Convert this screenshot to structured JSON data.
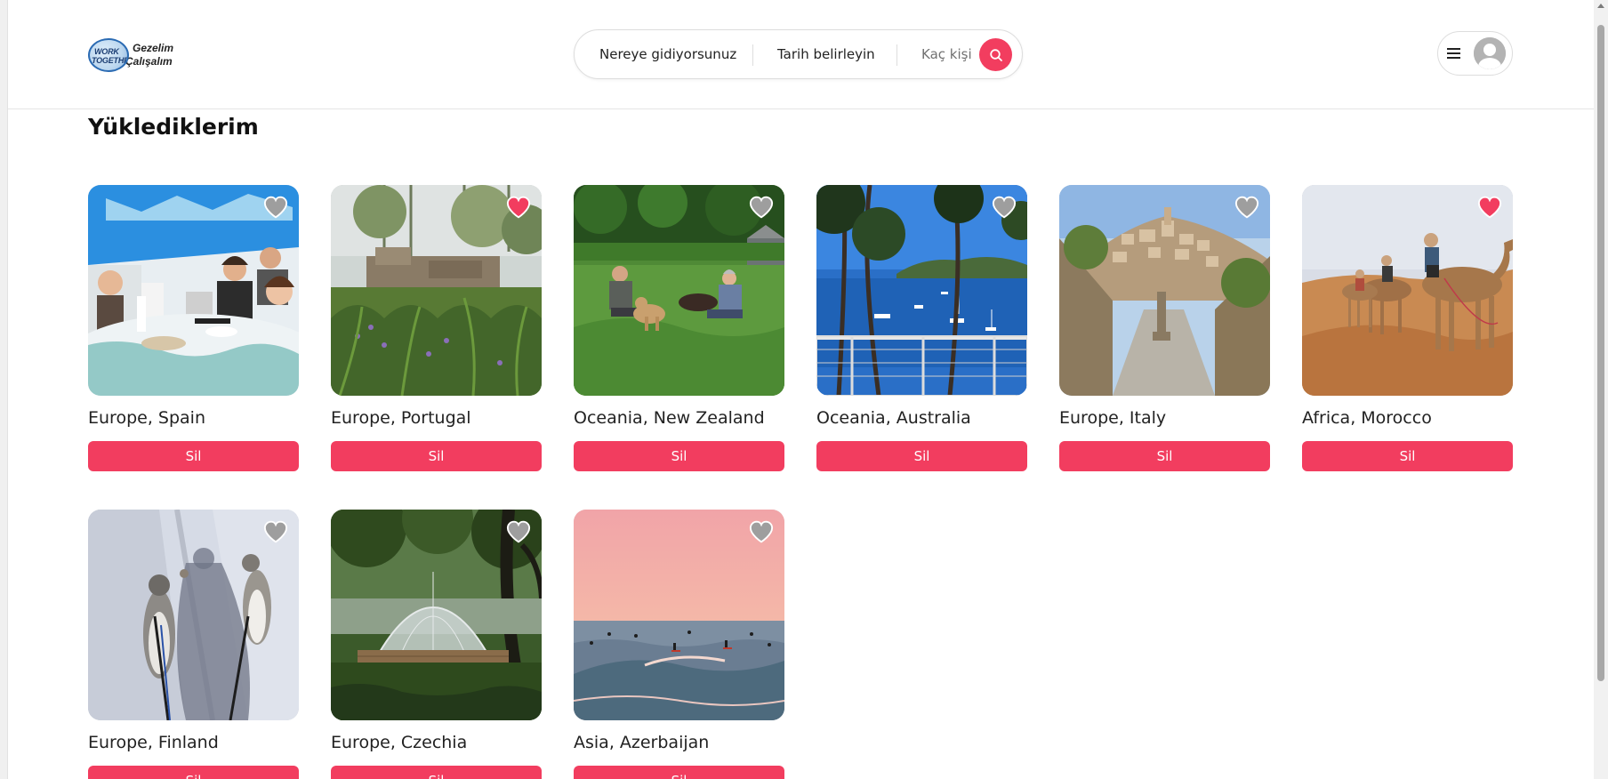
{
  "header": {
    "logo": {
      "line1": "WORK",
      "line2": "TOGETHER!",
      "text1": "Gezelim",
      "text2": "Çalışalım"
    },
    "search": {
      "where": "Nereye gidiyorsunuz",
      "date": "Tarih belirleyin",
      "guests": "Kaç kişi"
    }
  },
  "colors": {
    "accent": "#f23d5f",
    "heart_inactive": "#9e9e9e"
  },
  "main": {
    "title": "Yüklediklerim",
    "delete_label": "Sil",
    "listings": [
      {
        "location": "Europe, Spain",
        "favorite": false,
        "image": "family-dinner"
      },
      {
        "location": "Europe, Portugal",
        "favorite": true,
        "image": "stone-ruins-garden"
      },
      {
        "location": "Oceania, New Zealand",
        "favorite": false,
        "image": "couple-with-dog-on-grass"
      },
      {
        "location": "Oceania, Australia",
        "favorite": false,
        "image": "bay-with-boats"
      },
      {
        "location": "Europe, Italy",
        "favorite": false,
        "image": "hilltop-village"
      },
      {
        "location": "Africa, Morocco",
        "favorite": true,
        "image": "camels-in-desert"
      },
      {
        "location": "Europe, Finland",
        "favorite": false,
        "image": "huskies-in-snow"
      },
      {
        "location": "Europe, Czechia",
        "favorite": false,
        "image": "dome-tent-in-forest"
      },
      {
        "location": "Asia, Azerbaijan",
        "favorite": false,
        "image": "surfers-at-sunset"
      }
    ]
  }
}
